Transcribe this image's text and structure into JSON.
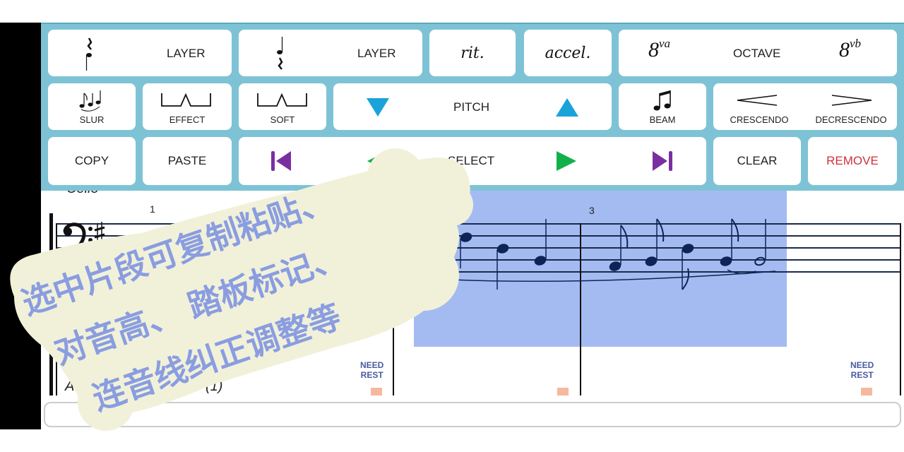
{
  "toolbar": {
    "row1": {
      "layer_up_label": "LAYER",
      "layer_down_label": "LAYER",
      "rit_label": "rit.",
      "accel_label": "accel.",
      "octave": {
        "up": "8",
        "up_sup": "va",
        "label": "OCTAVE",
        "down": "8",
        "down_sup": "vb"
      }
    },
    "row2": {
      "slur_label": "SLUR",
      "effect_label": "EFFECT",
      "soft_label": "SOFT",
      "pitch_label": "PITCH",
      "beam_label": "BEAM",
      "crescendo_label": "CRESCENDO",
      "decrescendo_label": "DECRESCENDO"
    },
    "row3": {
      "copy_label": "COPY",
      "paste_label": "PASTE",
      "select_label": "SELECT",
      "clear_label": "CLEAR",
      "remove_label": "REMOVE"
    },
    "colors": {
      "background": "#7ec3d5",
      "pitch_arrows": "#1aa3d9",
      "select_outer_arrows": "#7a2fa0",
      "select_inner_arrows": "#12b04a",
      "remove_text": "#d0303a"
    }
  },
  "score": {
    "instrument_top": "Cello",
    "instrument_bottom": "Acoustic Grand Piano (1)",
    "measure_numbers": [
      "1",
      "3"
    ],
    "need_rest_label_1": "NEED",
    "need_rest_label_2": "REST",
    "selection_color": "#a4bbf2"
  },
  "overlay": {
    "line1": "选中片段可复制粘贴、",
    "line2": "对音高、 踏板标记、",
    "line3": "连音线纠正调整等",
    "bubble_color": "#f1f1da",
    "text_color": "#8a9de0"
  }
}
